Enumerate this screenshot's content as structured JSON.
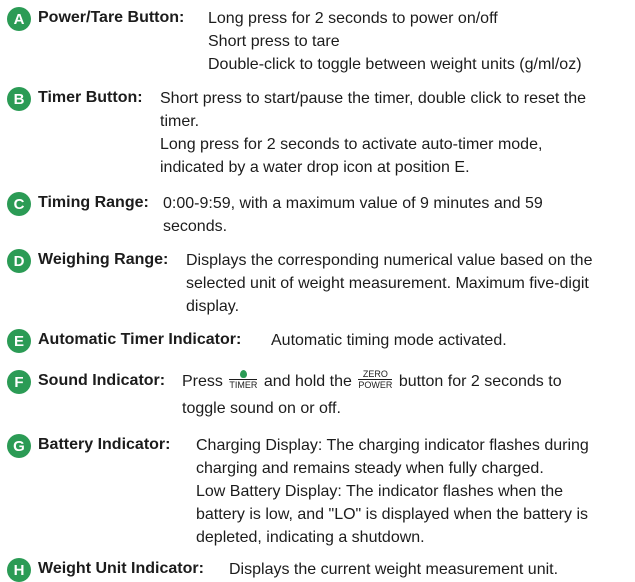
{
  "items": [
    {
      "letter": "A",
      "title": "Power/Tare Button:",
      "lines": [
        "Long press for 2 seconds to power on/off",
        "Short press to tare",
        "Double-click to toggle between weight units (g/ml/oz)"
      ]
    },
    {
      "letter": "B",
      "title": "Timer Button:",
      "lines": [
        "Short press to start/pause the timer, double click to reset the",
        "timer.",
        "Long press for 2 seconds to activate auto-timer mode,",
        "indicated by a water drop icon at position E."
      ]
    },
    {
      "letter": "C",
      "title": "Timing Range:",
      "lines": [
        "0:00-9:59, with a maximum value of 9 minutes and 59",
        "seconds."
      ]
    },
    {
      "letter": "D",
      "title": "Weighing Range:",
      "lines": [
        "Displays the corresponding numerical value based on the",
        "selected unit of weight measurement. Maximum five-digit",
        "display."
      ]
    },
    {
      "letter": "E",
      "title": "Automatic Timer Indicator:",
      "lines": [
        "Automatic timing mode activated."
      ]
    },
    {
      "letter": "F",
      "title": "Sound Indicator:",
      "line1_pre": "Press",
      "timer_label": "TIMER",
      "line1_mid": "and hold the",
      "zero_label": "ZERO",
      "power_label": "POWER",
      "line1_post": "button for 2 seconds to",
      "lines": [
        "toggle sound on or off."
      ]
    },
    {
      "letter": "G",
      "title": "Battery Indicator:",
      "lines": [
        "Charging Display: The charging indicator flashes during",
        "charging and remains steady when fully charged.",
        "Low Battery Display: The indicator flashes when the",
        "battery is low, and \"LO\" is displayed when the battery is",
        "depleted, indicating a shutdown."
      ]
    },
    {
      "letter": "H",
      "title": "Weight Unit Indicator:",
      "lines": [
        "Displays the current weight measurement unit."
      ]
    }
  ]
}
